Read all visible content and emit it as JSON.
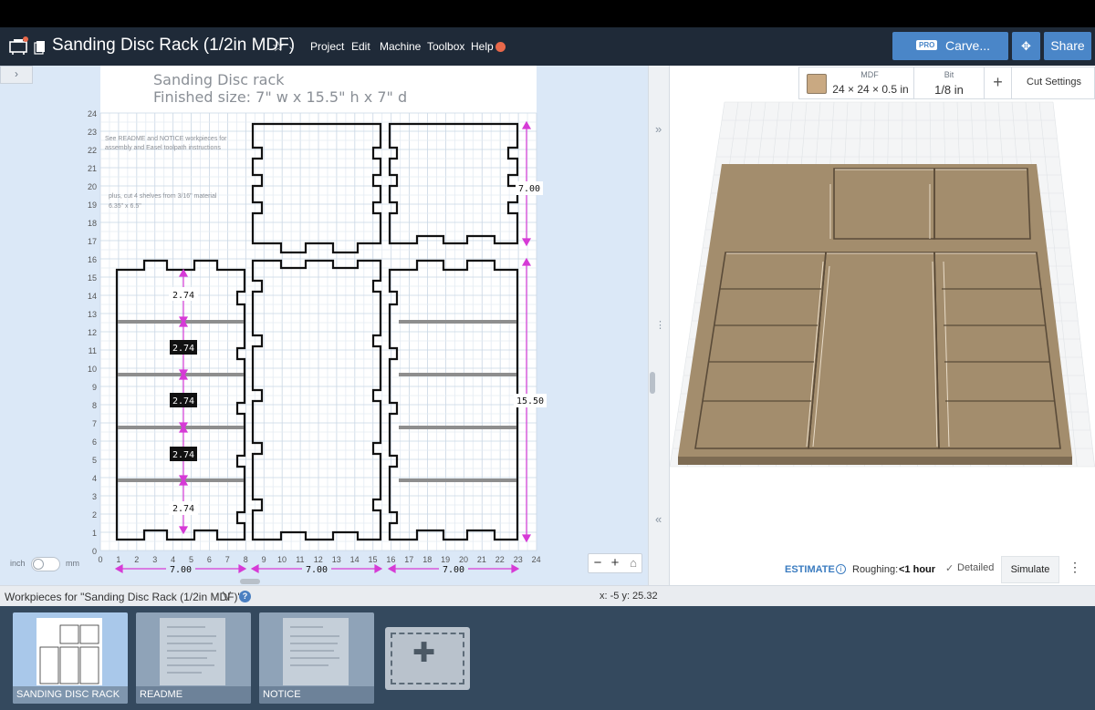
{
  "header": {
    "title": "Sanding Disc Rack (1/2in MDF)",
    "menu": [
      "Project",
      "Edit",
      "Machine",
      "Toolbox",
      "Help"
    ],
    "carve": {
      "badge": "PRO",
      "label": "Carve..."
    },
    "share_label": "Share",
    "icons": [
      "machine-icon",
      "document-icon",
      "star-icon",
      "chevron-down-icon",
      "move-icon"
    ]
  },
  "canvas": {
    "collapse_label": "›",
    "heading_line1": "Sanding Disc rack",
    "heading_line2": "Finished size:  7\" w x 15.5\" h x 7\" d",
    "note1_line1": "See README and NOTICE workpieces for",
    "note1_line2": "assembly and Easel toolpath instructions",
    "note2_line1": "plus, cut 4 shelves from 3/16\" material",
    "note2_line2": "6.35\" x 6.5\"",
    "y_ticks": [
      "24",
      "23",
      "22",
      "21",
      "20",
      "19",
      "18",
      "17",
      "16",
      "15",
      "14",
      "13",
      "12",
      "11",
      "10",
      "9",
      "8",
      "7",
      "6",
      "5",
      "4",
      "3",
      "2",
      "1",
      "0"
    ],
    "x_ticks": [
      "0",
      "1",
      "2",
      "3",
      "4",
      "5",
      "6",
      "7",
      "8",
      "9",
      "10",
      "11",
      "12",
      "13",
      "14",
      "15",
      "16",
      "17",
      "18",
      "19",
      "20",
      "21",
      "22",
      "23",
      "24"
    ],
    "dim_top_height": "7.00",
    "dim_bottom_height": "15.50",
    "dim_widths": [
      "7.00",
      "7.00",
      "7.00"
    ],
    "shelf_spacings": [
      "2.74",
      "2.74",
      "2.74",
      "2.74",
      "2.74"
    ],
    "units": {
      "left": "inch",
      "right": "mm"
    },
    "zoom": {
      "minus": "−",
      "plus": "+",
      "home": "⌂"
    }
  },
  "preview": {
    "material": {
      "name": "MDF",
      "size": "24 × 24 × 0.5 in"
    },
    "bit": {
      "label": "Bit",
      "value": "1/8 in"
    },
    "add_label": "+",
    "cut_settings": "Cut Settings",
    "estimate": {
      "label": "ESTIMATE",
      "info": "i",
      "roughing_label": "Roughing:",
      "roughing_value": "<1 hour",
      "detailed_label": "Detailed",
      "check": "✓"
    },
    "simulate_label": "Simulate",
    "more_label": "⋮",
    "colors": {
      "mdf": "#a38d6d",
      "mdf_dark": "#6a5a45"
    }
  },
  "status": {
    "workpieces_label": "Workpieces for \"Sanding Disc Rack (1/2in MDF)\"",
    "chevron": "⋁",
    "help": "?",
    "coords": "x: -5 y: 25.32"
  },
  "workpieces": [
    {
      "label": "SANDING DISC RACK",
      "active": true
    },
    {
      "label": "README",
      "active": false
    },
    {
      "label": "NOTICE",
      "active": false
    }
  ],
  "splitter": {
    "right_chev": "»",
    "left_chev": "«",
    "grip": "⋮"
  }
}
